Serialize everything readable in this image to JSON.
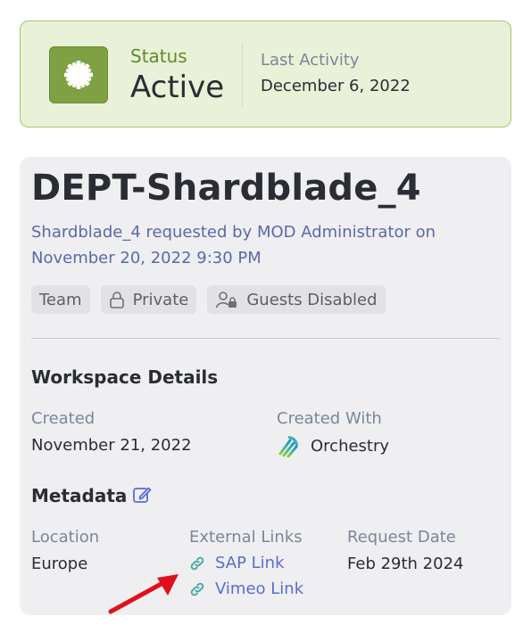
{
  "status": {
    "label": "Status",
    "value": "Active",
    "last_activity_label": "Last Activity",
    "last_activity_value": "December 6, 2022",
    "icon": "gear-badge-icon",
    "accent_color": "#7fa043"
  },
  "workspace": {
    "title": "DEPT-Shardblade_4",
    "request_text": "Shardblade_4 requested by MOD Administrator on November 20, 2022 9:30 PM",
    "chips": [
      {
        "label": "Team",
        "icon": ""
      },
      {
        "label": "Private",
        "icon": "lock-icon"
      },
      {
        "label": "Guests Disabled",
        "icon": "user-lock-icon"
      }
    ]
  },
  "details": {
    "title": "Workspace Details",
    "created_label": "Created",
    "created_value": "November 21, 2022",
    "created_with_label": "Created With",
    "created_with_value": "Orchestry"
  },
  "metadata": {
    "title": "Metadata",
    "location_label": "Location",
    "location_value": "Europe",
    "links_label": "External Links",
    "links": [
      {
        "label": "SAP Link",
        "icon": "link-icon"
      },
      {
        "label": "Vimeo Link",
        "icon": "link-icon"
      }
    ],
    "request_date_label": "Request Date",
    "request_date_value": "Feb 29th 2024"
  },
  "colors": {
    "link": "#5b6bd1",
    "annotation_arrow": "#e0101a"
  }
}
